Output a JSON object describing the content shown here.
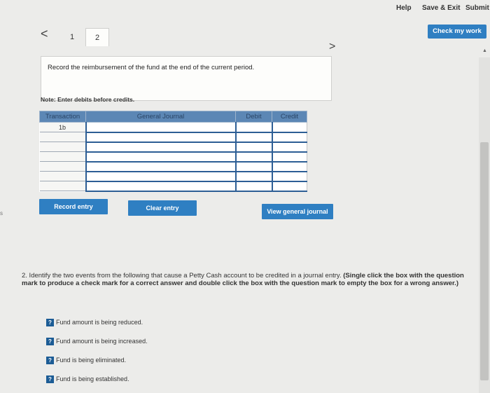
{
  "topbar": {
    "help": "Help",
    "save_exit": "Save & Exit",
    "submit": "Submit"
  },
  "check_work": "Check my work",
  "tabs": [
    "1",
    "2"
  ],
  "prompt": "Record the reimbursement of the fund at the end of the current period.",
  "note": "Note: Enter debits before credits.",
  "journal": {
    "headers": {
      "transaction": "Transaction",
      "general_journal": "General Journal",
      "debit": "Debit",
      "credit": "Credit"
    },
    "transaction_id": "1b"
  },
  "buttons": {
    "record": "Record entry",
    "clear": "Clear entry",
    "view": "View general journal"
  },
  "question2": {
    "text": "2. Identify the two events from the following that cause a Petty Cash account to be credited in a journal entry.",
    "instruction": "(Single click the box with the question mark to produce a check mark for a correct answer and double click the box with the question mark to empty the box for a wrong answer.)",
    "options": [
      "Fund amount is being reduced.",
      "Fund amount is being increased.",
      "Fund is being eliminated.",
      "Fund is being established."
    ],
    "mark": "?"
  }
}
